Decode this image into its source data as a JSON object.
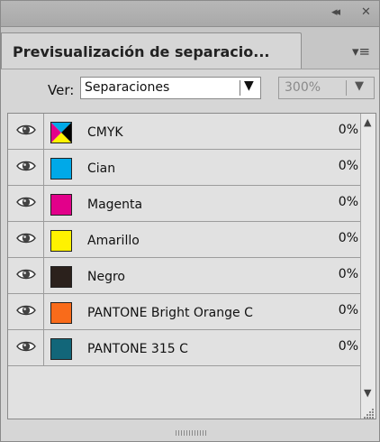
{
  "window": {
    "controls": {
      "collapse": "collapse-icon",
      "close": "close-icon"
    }
  },
  "tab": {
    "title": "Previsualización de separacio..."
  },
  "view": {
    "label": "Ver:",
    "mode_value": "Separaciones",
    "zoom_value": "300%"
  },
  "separations": [
    {
      "name": "CMYK",
      "percent": "0%",
      "swatch": "cmyk"
    },
    {
      "name": "Cian",
      "percent": "0%",
      "color": "#00a9e8"
    },
    {
      "name": "Magenta",
      "percent": "0%",
      "color": "#e2008a"
    },
    {
      "name": "Amarillo",
      "percent": "0%",
      "color": "#fff200"
    },
    {
      "name": "Negro",
      "percent": "0%",
      "color": "#2b211c"
    },
    {
      "name": "PANTONE Bright Orange C",
      "percent": "0%",
      "color": "#f96b1a"
    },
    {
      "name": "PANTONE 315 C",
      "percent": "0%",
      "color": "#126679"
    }
  ],
  "icons": {
    "visibility": "eye-icon",
    "panel_menu": "panel-menu-icon",
    "scroll_up": "scroll-up-icon",
    "scroll_down": "scroll-down-icon"
  }
}
